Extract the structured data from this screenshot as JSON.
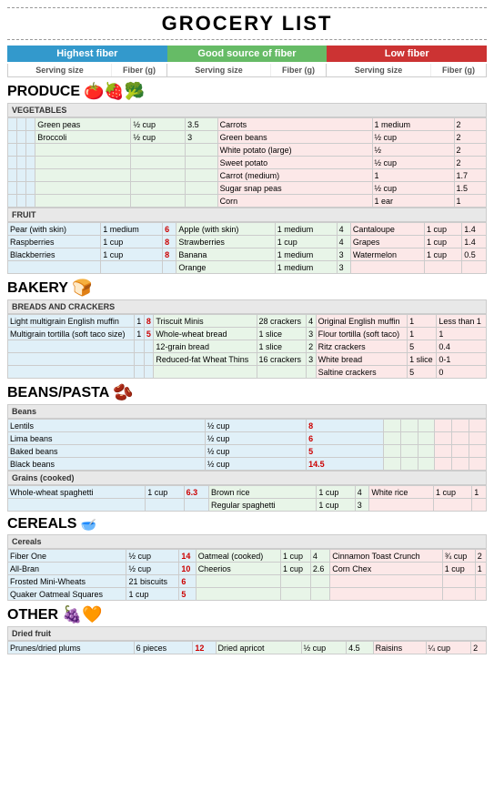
{
  "title": "GROCERY LIST",
  "legend": {
    "highest": "Highest fiber",
    "good": "Good source of fiber",
    "low": "Low fiber",
    "serving_label": "Serving size",
    "fiber_label": "Fiber (g)"
  },
  "sections": {
    "produce": {
      "label": "PRODUCE",
      "subsections": {
        "vegetables": {
          "label": "VEGETABLES",
          "rows": [
            {
              "high_item": "",
              "high_serving": "",
              "high_fiber": "",
              "good_item": "Green peas",
              "good_serving": "½ cup",
              "good_fiber": "3.5",
              "low_item": "Carrots",
              "low_serving": "1 medium",
              "low_fiber": "2"
            },
            {
              "high_item": "",
              "high_serving": "",
              "high_fiber": "",
              "good_item": "Broccoli",
              "good_serving": "½ cup",
              "good_fiber": "3",
              "low_item": "Green beans",
              "low_serving": "½ cup",
              "low_fiber": "2"
            },
            {
              "high_item": "",
              "high_serving": "",
              "high_fiber": "",
              "good_item": "",
              "good_serving": "",
              "good_fiber": "",
              "low_item": "White potato (large)",
              "low_serving": "½",
              "low_fiber": "2"
            },
            {
              "high_item": "",
              "high_serving": "",
              "high_fiber": "",
              "good_item": "",
              "good_serving": "",
              "good_fiber": "",
              "low_item": "Sweet potato",
              "low_serving": "½ cup",
              "low_fiber": "2"
            },
            {
              "high_item": "",
              "high_serving": "",
              "high_fiber": "",
              "good_item": "",
              "good_serving": "",
              "good_fiber": "",
              "low_item": "Carrot (medium)",
              "low_serving": "1",
              "low_fiber": "1.7"
            },
            {
              "high_item": "",
              "high_serving": "",
              "high_fiber": "",
              "good_item": "",
              "good_serving": "",
              "good_fiber": "",
              "low_item": "Sugar snap peas",
              "low_serving": "½ cup",
              "low_fiber": "1.5"
            },
            {
              "high_item": "",
              "high_serving": "",
              "high_fiber": "",
              "good_item": "",
              "good_serving": "",
              "good_fiber": "",
              "low_item": "Corn",
              "low_serving": "1 ear",
              "low_fiber": "1"
            }
          ]
        },
        "fruit": {
          "label": "FRUIT",
          "rows": [
            {
              "high_item": "Pear (with skin)",
              "high_serving": "1 medium",
              "high_fiber": "6",
              "good_item": "Apple (with skin)",
              "good_serving": "1 medium",
              "good_fiber": "4",
              "low_item": "Cantaloupe",
              "low_serving": "1 cup",
              "low_fiber": "1.4"
            },
            {
              "high_item": "Raspberries",
              "high_serving": "1 cup",
              "high_fiber": "8",
              "good_item": "Strawberries",
              "good_serving": "1 cup",
              "good_fiber": "4",
              "low_item": "Grapes",
              "low_serving": "1 cup",
              "low_fiber": "1.4"
            },
            {
              "high_item": "Blackberries",
              "high_serving": "1 cup",
              "high_fiber": "8",
              "good_item": "Banana",
              "good_serving": "1 medium",
              "good_fiber": "3",
              "low_item": "Watermelon",
              "low_serving": "1 cup",
              "low_fiber": "0.5"
            },
            {
              "high_item": "",
              "high_serving": "",
              "high_fiber": "",
              "good_item": "Orange",
              "good_serving": "1 medium",
              "good_fiber": "3",
              "low_item": "",
              "low_serving": "",
              "low_fiber": ""
            }
          ]
        }
      }
    },
    "bakery": {
      "label": "BAKERY",
      "subsections": {
        "breads": {
          "label": "BREADS AND CRACKERS",
          "rows": [
            {
              "high_item": "Light multigrain English muffin",
              "high_serving": "1",
              "high_fiber": "8",
              "good_item": "Triscuit Minis",
              "good_serving": "28 crackers",
              "good_fiber": "4",
              "low_item": "Original English muffin",
              "low_serving": "1",
              "low_fiber": "Less than 1"
            },
            {
              "high_item": "Multigrain tortilla (soft taco size)",
              "high_serving": "1",
              "high_fiber": "5",
              "good_item": "Whole-wheat bread",
              "good_serving": "1 slice",
              "good_fiber": "3",
              "low_item": "Flour tortilla (soft taco)",
              "low_serving": "1",
              "low_fiber": "1"
            },
            {
              "high_item": "",
              "high_serving": "",
              "high_fiber": "",
              "good_item": "12-grain bread",
              "good_serving": "1 slice",
              "good_fiber": "2",
              "low_item": "Ritz crackers",
              "low_serving": "5",
              "low_fiber": "0.4"
            },
            {
              "high_item": "",
              "high_serving": "",
              "high_fiber": "",
              "good_item": "Reduced-fat Wheat Thins",
              "good_serving": "16 crackers",
              "good_fiber": "3",
              "low_item": "White bread",
              "low_serving": "1 slice",
              "low_fiber": "0-1"
            },
            {
              "high_item": "",
              "high_serving": "",
              "high_fiber": "",
              "good_item": "",
              "good_serving": "",
              "good_fiber": "",
              "low_item": "Saltine crackers",
              "low_serving": "5",
              "low_fiber": "0"
            }
          ]
        }
      }
    },
    "beans_pasta": {
      "label": "BEANS/PASTA",
      "subsections": {
        "beans": {
          "label": "Beans",
          "rows": [
            {
              "high_item": "Lentils",
              "high_serving": "½ cup",
              "high_fiber": "8",
              "good_item": "",
              "good_serving": "",
              "good_fiber": "",
              "low_item": "",
              "low_serving": "",
              "low_fiber": ""
            },
            {
              "high_item": "Lima beans",
              "high_serving": "½ cup",
              "high_fiber": "6",
              "good_item": "",
              "good_serving": "",
              "good_fiber": "",
              "low_item": "",
              "low_serving": "",
              "low_fiber": ""
            },
            {
              "high_item": "Baked beans",
              "high_serving": "½ cup",
              "high_fiber": "5",
              "good_item": "",
              "good_serving": "",
              "good_fiber": "",
              "low_item": "",
              "low_serving": "",
              "low_fiber": ""
            },
            {
              "high_item": "Black beans",
              "high_serving": "½ cup",
              "high_fiber": "14.5",
              "good_item": "",
              "good_serving": "",
              "good_fiber": "",
              "low_item": "",
              "low_serving": "",
              "low_fiber": ""
            }
          ]
        },
        "grains": {
          "label": "Grains (cooked)",
          "rows": [
            {
              "high_item": "Whole-wheat spaghetti",
              "high_serving": "1 cup",
              "high_fiber": "6.3",
              "good_item": "Brown rice",
              "good_serving": "1 cup",
              "good_fiber": "4",
              "low_item": "White rice",
              "low_serving": "1 cup",
              "low_fiber": "1"
            },
            {
              "high_item": "",
              "high_serving": "",
              "high_fiber": "",
              "good_item": "Regular spaghetti",
              "good_serving": "1 cup",
              "good_fiber": "3",
              "low_item": "",
              "low_serving": "",
              "low_fiber": ""
            }
          ]
        }
      }
    },
    "cereals": {
      "label": "CEREALS",
      "subsections": {
        "cereals": {
          "label": "Cereals",
          "rows": [
            {
              "high_item": "Fiber One",
              "high_serving": "½ cup",
              "high_fiber": "14",
              "good_item": "Oatmeal (cooked)",
              "good_serving": "1 cup",
              "good_fiber": "4",
              "low_item": "Cinnamon Toast Crunch",
              "low_serving": "¾ cup",
              "low_fiber": "2"
            },
            {
              "high_item": "All-Bran",
              "high_serving": "½ cup",
              "high_fiber": "10",
              "good_item": "Cheerios",
              "good_serving": "1 cup",
              "good_fiber": "2.6",
              "low_item": "Corn Chex",
              "low_serving": "1 cup",
              "low_fiber": "1"
            },
            {
              "high_item": "Frosted Mini-Wheats",
              "high_serving": "21 biscuits",
              "high_fiber": "6",
              "good_item": "",
              "good_serving": "",
              "good_fiber": "",
              "low_item": "",
              "low_serving": "",
              "low_fiber": ""
            },
            {
              "high_item": "Quaker Oatmeal Squares",
              "high_serving": "1 cup",
              "high_fiber": "5",
              "good_item": "",
              "good_serving": "",
              "good_fiber": "",
              "low_item": "",
              "low_serving": "",
              "low_fiber": ""
            }
          ]
        }
      }
    },
    "other": {
      "label": "OTHER",
      "subsections": {
        "dried_fruit": {
          "label": "Dried fruit",
          "rows": [
            {
              "high_item": "Prunes/dried plums",
              "high_serving": "6 pieces",
              "high_fiber": "12",
              "good_item": "Dried apricot",
              "good_serving": "½ cup",
              "good_fiber": "4.5",
              "low_item": "Raisins",
              "low_serving": "¼ cup",
              "low_fiber": "2"
            }
          ]
        }
      }
    }
  }
}
